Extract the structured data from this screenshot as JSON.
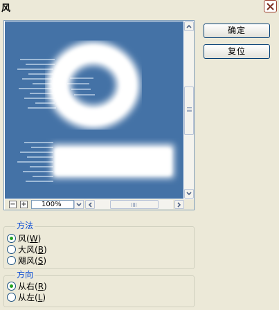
{
  "dialog": {
    "title": "风"
  },
  "buttons": {
    "ok": "确定",
    "reset": "复位"
  },
  "preview": {
    "zoom": "100%",
    "zoom_out": "−",
    "zoom_in": "+"
  },
  "method": {
    "legend": "方法",
    "options": [
      {
        "label": "风",
        "key": "W",
        "selected": true
      },
      {
        "label": "大风",
        "key": "B",
        "selected": false
      },
      {
        "label": "飓风",
        "key": "S",
        "selected": false
      }
    ]
  },
  "direction": {
    "legend": "方向",
    "options": [
      {
        "label": "从右",
        "key": "R",
        "selected": true
      },
      {
        "label": "从左",
        "key": "L",
        "selected": false
      }
    ]
  },
  "colors": {
    "preview_bg": "#4472A6",
    "accent": "#0046D5",
    "radio_check": "#21A121"
  }
}
